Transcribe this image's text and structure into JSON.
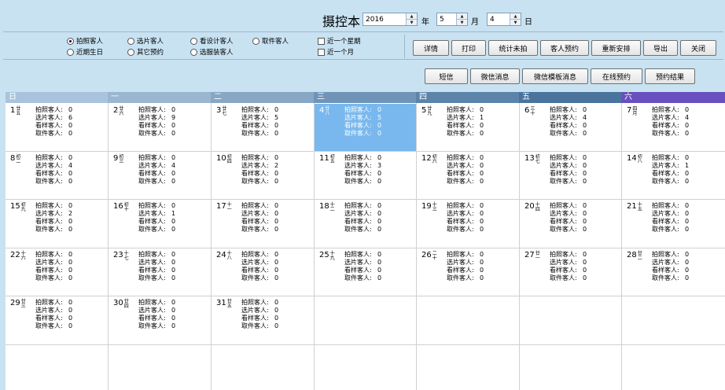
{
  "header": {
    "title": "摄控本",
    "year": "2016",
    "year_unit": "年",
    "month": "5",
    "month_unit": "月",
    "day": "4",
    "day_unit": "日"
  },
  "filters": {
    "radios": [
      {
        "label": "拍照客人",
        "selected": true
      },
      {
        "label": "选片客人",
        "selected": false
      },
      {
        "label": "看设计客人",
        "selected": false
      },
      {
        "label": "取件客人",
        "selected": false
      },
      {
        "label": "近期生日",
        "selected": false
      },
      {
        "label": "其它预约",
        "selected": false
      },
      {
        "label": "选服装客人",
        "selected": false
      }
    ],
    "checks": [
      {
        "label": "近一个星期",
        "checked": false
      },
      {
        "label": "近一个月",
        "checked": false
      }
    ]
  },
  "toolbar": {
    "row1": [
      "详情",
      "打印",
      "统计未拍",
      "客人预约",
      "重新安排",
      "导出",
      "关闭"
    ],
    "row2": [
      "短信",
      "微信消息",
      "微信模板消息",
      "在线预约",
      "预约结果"
    ]
  },
  "calendar": {
    "weekdays": [
      "日",
      "一",
      "二",
      "三",
      "四",
      "五",
      "六"
    ],
    "weekday_colors": [
      "#aac3dc",
      "#9ab6d0",
      "#87a7c4",
      "#6f94b8",
      "#5c84aa",
      "#4a749e",
      "#6a4fc0"
    ],
    "stat_labels": [
      "拍照客人:",
      "选片客人:",
      "看样客人:",
      "取件客人:"
    ],
    "selected_day": 4,
    "weeks": [
      [
        {
          "day": "1",
          "lunar": "廿五",
          "stats": [
            "0",
            "6",
            "0",
            "0"
          ]
        },
        {
          "day": "2",
          "lunar": "廿六",
          "stats": [
            "0",
            "9",
            "0",
            "0"
          ]
        },
        {
          "day": "3",
          "lunar": "廿七",
          "stats": [
            "0",
            "5",
            "0",
            "0"
          ]
        },
        {
          "day": "4",
          "lunar": "廿八",
          "stats": [
            "0",
            "5",
            "0",
            "0"
          ]
        },
        {
          "day": "5",
          "lunar": "廿九",
          "stats": [
            "0",
            "1",
            "0",
            "0"
          ]
        },
        {
          "day": "6",
          "lunar": "三十",
          "stats": [
            "0",
            "4",
            "0",
            "0"
          ]
        },
        {
          "day": "7",
          "lunar": "四月",
          "stats": [
            "0",
            "4",
            "0",
            "0"
          ]
        }
      ],
      [
        {
          "day": "8",
          "lunar": "初二",
          "stats": [
            "0",
            "4",
            "0",
            "0"
          ]
        },
        {
          "day": "9",
          "lunar": "初三",
          "stats": [
            "0",
            "4",
            "0",
            "0"
          ]
        },
        {
          "day": "10",
          "lunar": "初四",
          "stats": [
            "0",
            "2",
            "0",
            "0"
          ]
        },
        {
          "day": "11",
          "lunar": "初五",
          "stats": [
            "0",
            "3",
            "0",
            "0"
          ]
        },
        {
          "day": "12",
          "lunar": "初六",
          "stats": [
            "0",
            "0",
            "0",
            "0"
          ]
        },
        {
          "day": "13",
          "lunar": "初七",
          "stats": [
            "0",
            "0",
            "0",
            "0"
          ]
        },
        {
          "day": "14",
          "lunar": "初八",
          "stats": [
            "0",
            "1",
            "0",
            "0"
          ]
        }
      ],
      [
        {
          "day": "15",
          "lunar": "初九",
          "stats": [
            "0",
            "2",
            "0",
            "0"
          ]
        },
        {
          "day": "16",
          "lunar": "初十",
          "stats": [
            "0",
            "1",
            "0",
            "0"
          ]
        },
        {
          "day": "17",
          "lunar": "十一",
          "stats": [
            "0",
            "0",
            "0",
            "0"
          ]
        },
        {
          "day": "18",
          "lunar": "十二",
          "stats": [
            "0",
            "0",
            "0",
            "0"
          ]
        },
        {
          "day": "19",
          "lunar": "十三",
          "stats": [
            "0",
            "0",
            "0",
            "0"
          ]
        },
        {
          "day": "20",
          "lunar": "十四",
          "stats": [
            "0",
            "0",
            "0",
            "0"
          ]
        },
        {
          "day": "21",
          "lunar": "十五",
          "stats": [
            "0",
            "0",
            "0",
            "0"
          ]
        }
      ],
      [
        {
          "day": "22",
          "lunar": "十六",
          "stats": [
            "0",
            "0",
            "0",
            "0"
          ]
        },
        {
          "day": "23",
          "lunar": "十七",
          "stats": [
            "0",
            "0",
            "0",
            "0"
          ]
        },
        {
          "day": "24",
          "lunar": "十八",
          "stats": [
            "0",
            "0",
            "0",
            "0"
          ]
        },
        {
          "day": "25",
          "lunar": "十九",
          "stats": [
            "0",
            "0",
            "0",
            "0"
          ]
        },
        {
          "day": "26",
          "lunar": "二十",
          "stats": [
            "0",
            "0",
            "0",
            "0"
          ]
        },
        {
          "day": "27",
          "lunar": "廿一",
          "stats": [
            "0",
            "0",
            "0",
            "0"
          ]
        },
        {
          "day": "28",
          "lunar": "廿二",
          "stats": [
            "0",
            "0",
            "0",
            "0"
          ]
        }
      ],
      [
        {
          "day": "29",
          "lunar": "廿三",
          "stats": [
            "0",
            "0",
            "0",
            "0"
          ]
        },
        {
          "day": "30",
          "lunar": "廿四",
          "stats": [
            "0",
            "0",
            "0",
            "0"
          ]
        },
        {
          "day": "31",
          "lunar": "廿五",
          "stats": [
            "0",
            "0",
            "0",
            "0"
          ]
        },
        null,
        null,
        null,
        null
      ],
      [
        null,
        null,
        null,
        null,
        null,
        null,
        null
      ]
    ]
  }
}
